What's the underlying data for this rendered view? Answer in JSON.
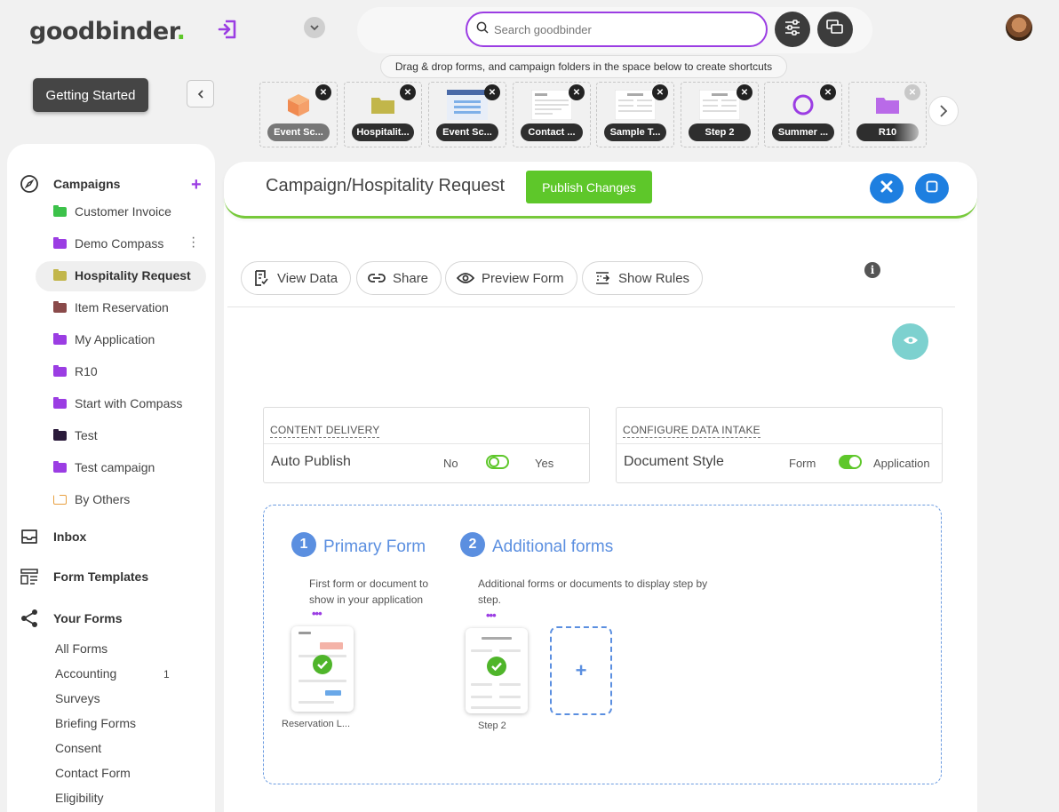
{
  "app": {
    "logo_text": "goodbinder",
    "logo_dot": ".",
    "brand_color": "#5ec72a",
    "accent_color": "#9b3de3"
  },
  "search": {
    "placeholder": "Search goodbinder"
  },
  "hint_text": "Drag & drop forms, and campaign folders in the space below to create shortcuts",
  "getting_started": "Getting Started",
  "shortcuts": [
    {
      "label": "Event Sc...",
      "icon": "box-icon"
    },
    {
      "label": "Hospitalit...",
      "icon": "folder-icon"
    },
    {
      "label": "Event Sc...",
      "icon": "form-thumb-icon"
    },
    {
      "label": "Contact ...",
      "icon": "form-thumb-icon"
    },
    {
      "label": "Sample T...",
      "icon": "form-thumb-icon"
    },
    {
      "label": "Step 2",
      "icon": "form-thumb-icon"
    },
    {
      "label": "Summer ...",
      "icon": "circle-icon"
    },
    {
      "label": "R10",
      "icon": "folder-icon"
    }
  ],
  "sidebar": {
    "campaigns_label": "Campaigns",
    "campaigns": [
      {
        "label": "Customer Invoice",
        "color": "#3cc24a"
      },
      {
        "label": "Demo Compass",
        "color": "#9b3de3"
      },
      {
        "label": "Hospitality Request",
        "color": "#c2b64a",
        "active": true
      },
      {
        "label": "Item Reservation",
        "color": "#8a4a4a"
      },
      {
        "label": "My Application",
        "color": "#9b3de3"
      },
      {
        "label": "R10",
        "color": "#9b3de3"
      },
      {
        "label": "Start with Compass",
        "color": "#9b3de3"
      },
      {
        "label": "Test",
        "color": "#2a1a3a"
      },
      {
        "label": "Test campaign",
        "color": "#9b3de3"
      },
      {
        "label": "By Others",
        "color": "#e8a040"
      }
    ],
    "inbox_label": "Inbox",
    "templates_label": "Form Templates",
    "your_forms_label": "Your Forms",
    "forms": [
      {
        "label": "All Forms",
        "count": ""
      },
      {
        "label": "Accounting",
        "count": "1"
      },
      {
        "label": "Surveys",
        "count": ""
      },
      {
        "label": "Briefing Forms",
        "count": ""
      },
      {
        "label": "Consent",
        "count": ""
      },
      {
        "label": "Contact Form",
        "count": ""
      },
      {
        "label": "Eligibility",
        "count": ""
      }
    ]
  },
  "main": {
    "title": "Campaign/Hospitality Request",
    "publish_label": "Publish Changes",
    "actions": [
      {
        "label": "View Data",
        "icon": "view-data-icon"
      },
      {
        "label": "Share",
        "icon": "link-icon"
      },
      {
        "label": "Preview Form",
        "icon": "eye-icon"
      },
      {
        "label": "Show Rules",
        "icon": "rules-icon"
      }
    ],
    "content_delivery": {
      "title": "CONTENT DELIVERY",
      "label": "Auto Publish",
      "off_label": "No",
      "on_label": "Yes",
      "value": "No"
    },
    "data_intake": {
      "title": "CONFIGURE DATA INTAKE",
      "label": "Document Style",
      "off_label": "Form",
      "on_label": "Application",
      "value": "Application"
    },
    "steps": {
      "primary": {
        "num": "1",
        "title": "Primary Form",
        "desc": "First form or document to show in your application",
        "doc_label": "Reservation L..."
      },
      "additional": {
        "num": "2",
        "title": "Additional forms",
        "desc": "Additional forms or documents to display step by step.",
        "doc_label": "Step 2"
      },
      "add_symbol": "+"
    }
  }
}
